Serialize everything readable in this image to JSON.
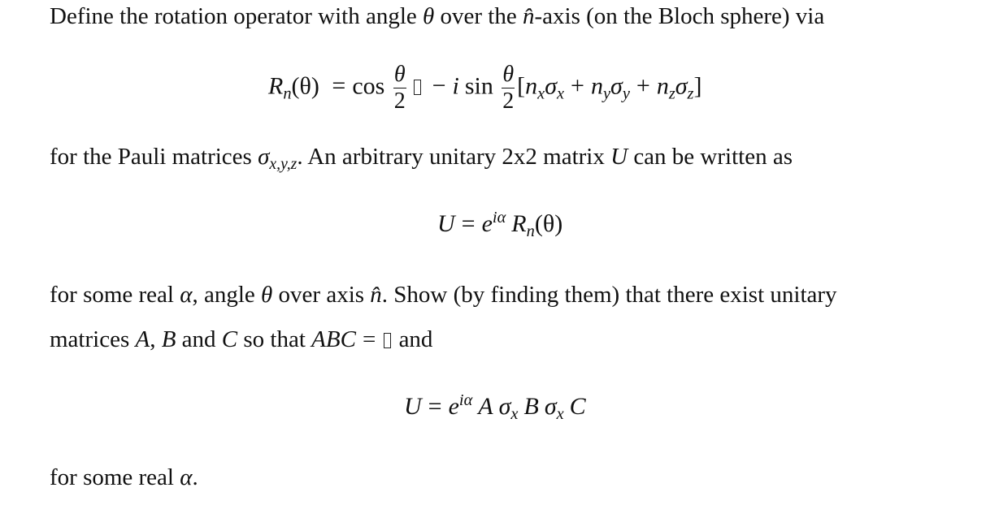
{
  "document": {
    "paragraph1": {
      "text_before_theta": "Define the rotation operator with angle ",
      "theta": "θ",
      "text_over_the": " over the ",
      "n_hat": "n̂",
      "text_after": "-axis (on the Bloch sphere) via"
    },
    "equation1": {
      "lhs_R": "R",
      "lhs_sub": "n",
      "lhs_arg": "(θ)",
      "equals": "=",
      "cos": "cos",
      "frac_num": "θ",
      "frac_den": "2",
      "minus": "−",
      "i": "i",
      "sin": "sin",
      "bracket_open": "[",
      "n": "n",
      "sigma": "σ",
      "sub_x": "x",
      "sub_y": "y",
      "sub_z": "z",
      "plus": "+",
      "bracket_close": "]"
    },
    "paragraph2": {
      "text_before": "for the Pauli matrices ",
      "sigma": "σ",
      "sigma_sub": "x,y,z",
      "text_after": ". An arbitrary unitary 2x2 matrix ",
      "U": "U",
      "text_end": " can be written as"
    },
    "equation2": {
      "U": "U",
      "equals": "=",
      "e": "e",
      "exponent": "iα",
      "R": "R",
      "R_sub": "n",
      "arg": "(θ)"
    },
    "paragraph3": {
      "text1": "for some real ",
      "alpha": "α",
      "text2": ", angle ",
      "theta": "θ",
      "text3": " over axis ",
      "n_hat": "n̂",
      "text4": ". Show (by finding them) that there exist unitary"
    },
    "paragraph4": {
      "text1": "matrices ",
      "A": "A",
      "comma": ", ",
      "B": "B",
      "text2": " and ",
      "C": "C",
      "text3": " so that ",
      "ABC": "ABC",
      "equals": "=",
      "text4": " and"
    },
    "equation3": {
      "U": "U",
      "equals": "=",
      "e": "e",
      "exponent": "iα",
      "A": "A",
      "sigma": "σ",
      "sigma_sub": "x",
      "B": "B",
      "C": "C"
    },
    "paragraph5": {
      "text1": "for some real ",
      "alpha": "α",
      "period": "."
    }
  }
}
